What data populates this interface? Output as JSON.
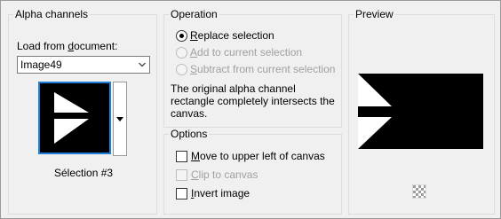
{
  "alpha_channels": {
    "title": "Alpha channels",
    "load_label_prefix": "Load from ",
    "load_label_underlined": "d",
    "load_label_suffix": "ocument:",
    "document_value": "Image49",
    "selection_name": "Sélection #3"
  },
  "operation": {
    "title": "Operation",
    "options": [
      {
        "label_u": "R",
        "label_rest": "eplace selection",
        "selected": true,
        "enabled": true
      },
      {
        "label_u": "A",
        "label_rest": "dd to current selection",
        "selected": false,
        "enabled": false
      },
      {
        "label_u": "S",
        "label_rest": "ubtract from current selection",
        "selected": false,
        "enabled": false
      }
    ],
    "description": "The original alpha channel rectangle completely intersects the canvas."
  },
  "options": {
    "title": "Options",
    "move_u": "M",
    "move_rest": "ove to upper left of canvas",
    "move_checked": false,
    "clip_u": "C",
    "clip_rest": "lip to canvas",
    "clip_checked": false,
    "clip_enabled": false,
    "invert_u": "I",
    "invert_rest": "nvert image",
    "invert_checked": false
  },
  "preview": {
    "title": "Preview"
  },
  "colors": {
    "accent": "#1f7fd8",
    "bg": "#f0f0f0"
  }
}
